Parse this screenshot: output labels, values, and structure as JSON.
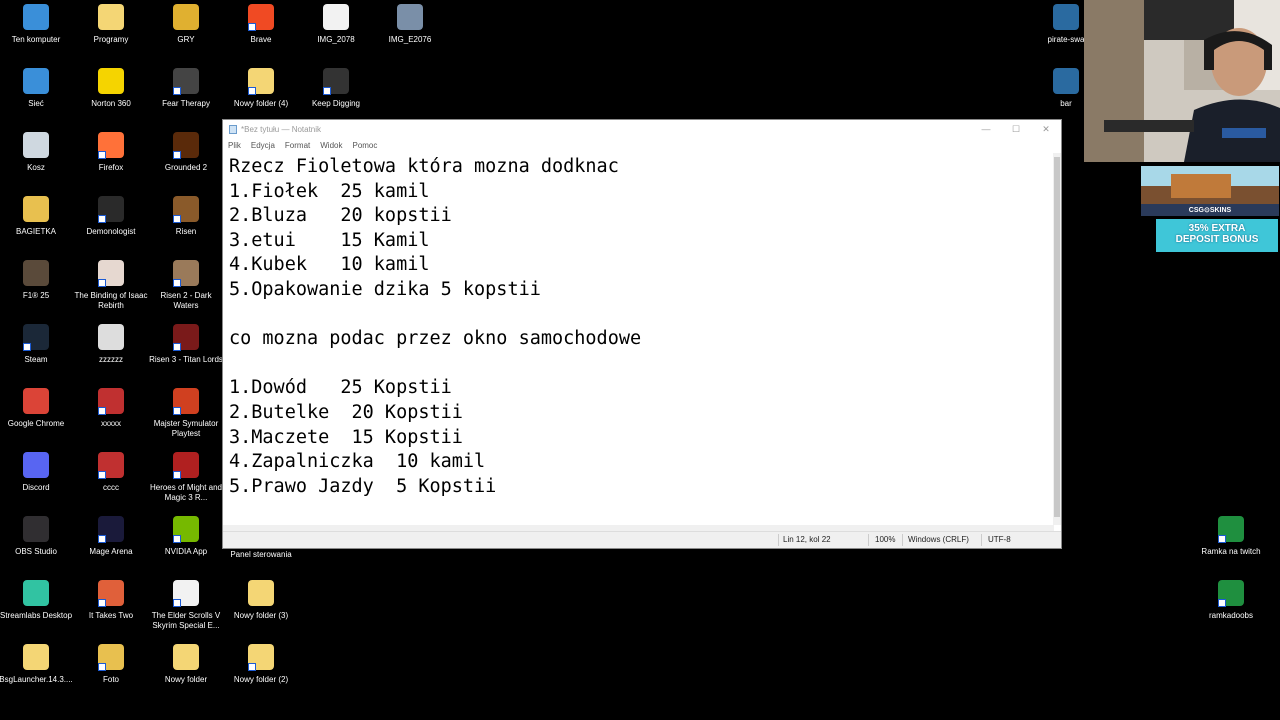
{
  "desktop_icons": [
    {
      "label": "Ten komputer",
      "name": "ten-komputer-icon",
      "color": "#3a8fd9"
    },
    {
      "label": "Programy",
      "name": "programy-folder-icon",
      "color": "#f4d675"
    },
    {
      "label": "GRY",
      "name": "gry-folder-icon",
      "color": "#e0b030"
    },
    {
      "label": "Brave",
      "name": "brave-icon",
      "color": "#f04a23"
    },
    {
      "label": "IMG_2078",
      "name": "img-2078-icon",
      "color": "#f2f2f2"
    },
    {
      "label": "IMG_E2076",
      "name": "img-e2076-icon",
      "color": "#7a8fa8"
    },
    {
      "label": "Sieć",
      "name": "siec-icon",
      "color": "#3a8fd9"
    },
    {
      "label": "Norton 360",
      "name": "norton-360-icon",
      "color": "#f5d400"
    },
    {
      "label": "Fear Therapy",
      "name": "fear-therapy-icon",
      "color": "#444444"
    },
    {
      "label": "Nowy folder (4)",
      "name": "nowy-folder-4-icon",
      "color": "#f4d675"
    },
    {
      "label": "Keep Digging",
      "name": "keep-digging-icon",
      "color": "#333333"
    },
    {
      "label": "Kosz",
      "name": "kosz-icon",
      "color": "#cfd8e0"
    },
    {
      "label": "Firefox",
      "name": "firefox-icon",
      "color": "#ff7139"
    },
    {
      "label": "Grounded 2",
      "name": "grounded-2-icon",
      "color": "#5a2a0a"
    },
    {
      "label": "BAGIETKA",
      "name": "bagietka-icon",
      "color": "#e8c04f"
    },
    {
      "label": "Demonologist",
      "name": "demonologist-icon",
      "color": "#2a2a2a"
    },
    {
      "label": "Risen",
      "name": "risen-icon",
      "color": "#8a5a2a"
    },
    {
      "label": "F1® 25",
      "name": "f1-25-icon",
      "color": "#5a4a3a"
    },
    {
      "label": "The Binding of Isaac Rebirth",
      "name": "binding-of-isaac-icon",
      "color": "#e6d8d0"
    },
    {
      "label": "Risen 2 - Dark Waters",
      "name": "risen-2-icon",
      "color": "#9a7a5a"
    },
    {
      "label": "Steam",
      "name": "steam-icon",
      "color": "#1b2838"
    },
    {
      "label": "zzzzzz",
      "name": "zzzzzz-icon",
      "color": "#dddddd"
    },
    {
      "label": "Risen 3 - Titan Lords",
      "name": "risen-3-icon",
      "color": "#7a1a1a"
    },
    {
      "label": "Google Chrome",
      "name": "google-chrome-icon",
      "color": "#db4437"
    },
    {
      "label": "xxxxx",
      "name": "xxxxx-icon",
      "color": "#c03030"
    },
    {
      "label": "Majster Symulator Playtest",
      "name": "majster-symulator-icon",
      "color": "#d04020"
    },
    {
      "label": "Discord",
      "name": "discord-icon",
      "color": "#5865f2"
    },
    {
      "label": "cccc",
      "name": "cccc-icon",
      "color": "#c03030"
    },
    {
      "label": "Heroes of Might and Magic 3 R...",
      "name": "heroes-3-icon",
      "color": "#b02020"
    },
    {
      "label": "OBS Studio",
      "name": "obs-studio-icon",
      "color": "#302e31"
    },
    {
      "label": "Mage Arena",
      "name": "mage-arena-icon",
      "color": "#1a1a3a"
    },
    {
      "label": "NVIDIA App",
      "name": "nvidia-app-icon",
      "color": "#76b900"
    },
    {
      "label": "Streamlabs Desktop",
      "name": "streamlabs-desktop-icon",
      "color": "#31c3a2"
    },
    {
      "label": "It Takes Two",
      "name": "it-takes-two-icon",
      "color": "#e0603a"
    },
    {
      "label": "The Elder Scrolls V Skyrim Special E...",
      "name": "skyrim-icon",
      "color": "#f2f2f2"
    },
    {
      "label": "Nowy folder (3)",
      "name": "nowy-folder-3-icon",
      "color": "#f4d675"
    },
    {
      "label": "BsgLauncher.14.3....",
      "name": "bsglauncher-icon",
      "color": "#f4d675"
    },
    {
      "label": "Foto",
      "name": "foto-icon",
      "color": "#e8c04f"
    },
    {
      "label": "Nowy folder",
      "name": "nowy-folder-icon",
      "color": "#f4d675"
    },
    {
      "label": "Nowy folder (2)",
      "name": "nowy-folder-2-icon",
      "color": "#f4d675"
    },
    {
      "label": "pirate-swa",
      "name": "pirate-swa-icon",
      "color": "#2a6aa0"
    },
    {
      "label": "bar",
      "name": "bar-icon",
      "color": "#2a6aa0"
    },
    {
      "label": "Ramka na twitch",
      "name": "ramka-na-twitch-icon",
      "color": "#1f8f3f"
    },
    {
      "label": "ramkadoobs",
      "name": "ramkadoobs-icon",
      "color": "#1f8f3f"
    },
    {
      "label": "Panel sterowania",
      "name": "panel-sterowania-icon",
      "color": "#3a8fd9"
    }
  ],
  "notepad": {
    "title": "*Bez tytułu — Notatnik",
    "menu": [
      "Plik",
      "Edycja",
      "Format",
      "Widok",
      "Pomoc"
    ],
    "lines": [
      "Rzecz Fioletowa która mozna dodknac",
      "1.Fiołek  25 kamil",
      "2.Bluza   20 kopstii",
      "3.etui    15 Kamil",
      "4.Kubek   10 kamil",
      "5.Opakowanie dzika 5 kopstii",
      "",
      "co mozna podac przez okno samochodowe",
      "",
      "1.Dowód   25 Kopstii",
      "2.Butelke  20 Kopstii",
      "3.Maczete  15 Kopstii",
      "4.Zapalniczka  10 kamil",
      "5.Prawo Jazdy  5 Kopstii"
    ],
    "status": {
      "position": "Lin 12, kol 22",
      "zoom": "100%",
      "line_ending": "Windows (CRLF)",
      "encoding": "UTF-8"
    }
  },
  "overlay": {
    "ad1_text": "CSG⊙SKINS",
    "ad2_text": "35% EXTRA DEPOSIT BONUS"
  }
}
